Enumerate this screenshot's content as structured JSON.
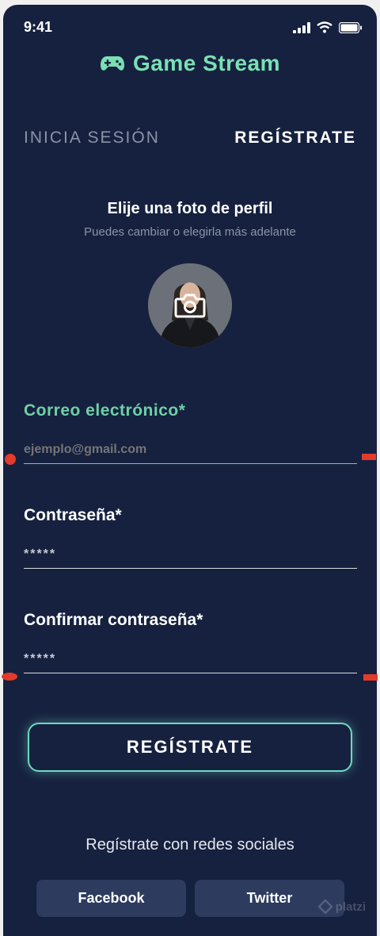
{
  "status_bar": {
    "time": "9:41"
  },
  "brand": {
    "name": "Game Stream",
    "icon": "gamepad-icon",
    "color": "#7ae0b4"
  },
  "tabs": {
    "login": "INICIA SESIÓN",
    "register": "REGÍSTRATE"
  },
  "profile_photo": {
    "title": "Elije una foto de perfil",
    "subtitle": "Puedes cambiar o elegirla más adelante",
    "icon": "camera-icon"
  },
  "form": {
    "email_label": "Correo electrónico*",
    "email_placeholder": "ejemplo@gmail.com",
    "password_label": "Contraseña*",
    "password_value": "*****",
    "confirm_label": "Confirmar contraseña*",
    "confirm_value": "*****"
  },
  "submit_label": "REGÍSTRATE",
  "social": {
    "title": "Regístrate con redes sociales",
    "facebook": "Facebook",
    "twitter": "Twitter"
  },
  "watermark": "platzi",
  "colors": {
    "background": "#16213f",
    "accent": "#6fd0a6",
    "button_border": "#6fd8c0",
    "social_button": "#2c3b5e",
    "annotation_mark": "#e33b2a"
  }
}
